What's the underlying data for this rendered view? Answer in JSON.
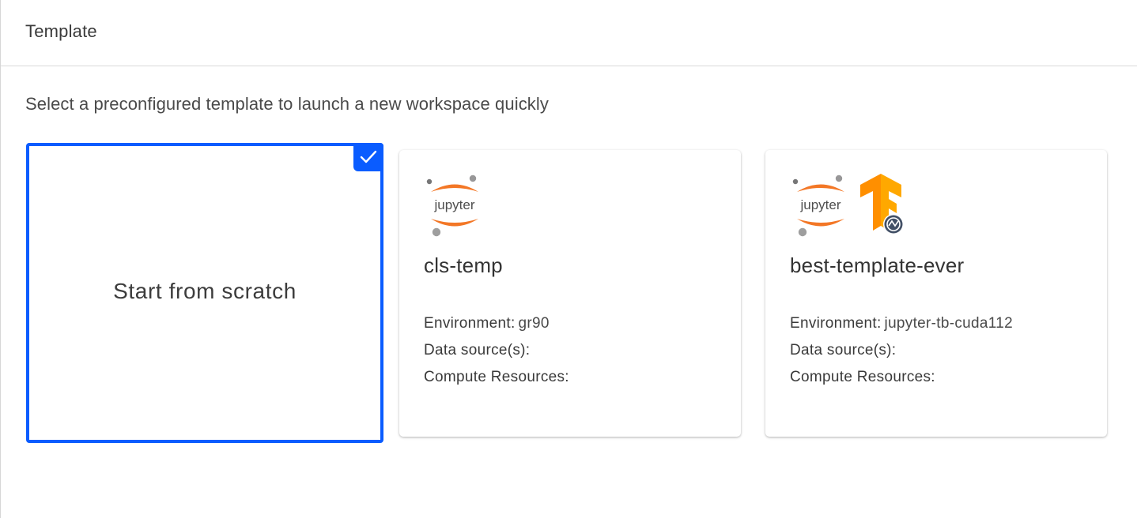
{
  "header": {
    "title": "Template"
  },
  "subtitle": "Select a preconfigured template to launch a new workspace quickly",
  "scratch": {
    "label": "Start from scratch",
    "selected": true
  },
  "accent_color": "#0a5cff",
  "templates": [
    {
      "name": "cls-temp",
      "logos": [
        "jupyter-logo-icon"
      ],
      "environment_label": "Environment:",
      "environment_value": "gr90",
      "data_sources_label": "Data source(s):",
      "compute_label": "Compute Resources:"
    },
    {
      "name": "best-template-ever",
      "logos": [
        "jupyter-logo-icon",
        "tensorflow-logo-icon"
      ],
      "environment_label": "Environment:",
      "environment_value": "jupyter-tb-cuda112",
      "data_sources_label": "Data source(s):",
      "compute_label": "Compute Resources:"
    }
  ],
  "logo_text": {
    "jupyter": "jupyter"
  }
}
